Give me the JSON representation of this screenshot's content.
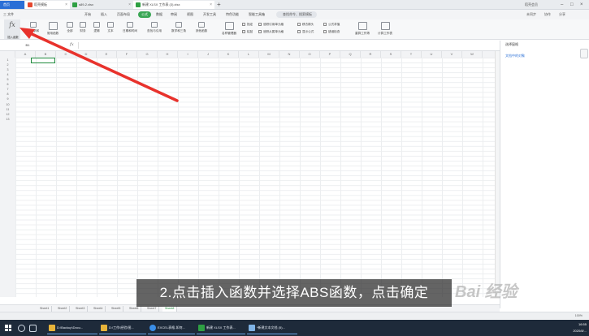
{
  "tabs": {
    "home": "首页",
    "daoke": "稻壳模板",
    "file1": "s89-2.xlsx",
    "file2": "新建 XLSX 工作表 (3).xlsx",
    "plus": "+"
  },
  "window_right": {
    "avatar_label": "稻壳会员",
    "share": "分享"
  },
  "menu": {
    "file": "三 文件",
    "items": [
      "开始",
      "插入",
      "页面布局",
      "公式",
      "数据",
      "审阅",
      "视图",
      "开发工具",
      "特色功能",
      "智能工具箱"
    ],
    "active_index": 3,
    "search": "查找命令、搜索模板",
    "right_items": [
      "未同步",
      "协作",
      "分享"
    ]
  },
  "ribbon": {
    "insert_function": "插入函数",
    "buttons": [
      "自动求和",
      "常用函数",
      "全部",
      "财务",
      "逻辑",
      "文本",
      "日期和时间",
      "查找与引用",
      "数学和三角",
      "其他函数",
      "名称管理器"
    ],
    "small_buttons": [
      "指定",
      "追踪引用单元格",
      "移去箭头",
      "公式求值",
      "粘贴",
      "追踪从属单元格",
      "显示公式",
      "错误检查",
      "重算工作簿",
      "计算工作表"
    ]
  },
  "formula_bar": {
    "cell_ref": "B1",
    "fx": "fx",
    "value": ""
  },
  "columns": [
    "A",
    "B",
    "C",
    "D",
    "E",
    "F",
    "G",
    "H",
    "I",
    "J",
    "K",
    "L",
    "M",
    "N",
    "O",
    "P",
    "Q",
    "R",
    "S",
    "T",
    "U",
    "V",
    "W"
  ],
  "rows": [
    "1",
    "2",
    "3",
    "4",
    "5",
    "6",
    "7",
    "8",
    "9",
    "10",
    "11",
    "12",
    "13"
  ],
  "task_pane": {
    "title": "选择窗格",
    "link": "文档中的对象"
  },
  "sheets": [
    "Sheet1",
    "Sheet2",
    "Sheet3",
    "Sheet4",
    "Sheet5",
    "Sheet6",
    "Sheet7",
    "Sheet8"
  ],
  "active_sheet_index": 7,
  "status": {
    "zoom": "100%"
  },
  "subtitle": "2.点击插入函数并选择ABS函数，点击确定",
  "watermark": "Bai 经验",
  "taskbar": {
    "apps": [
      "D:\\Backup\\Docu...",
      "D:\\工作\\经验\\图...",
      "EXCEL表格-如何...",
      "新建 XLSX 工作表...",
      "*新建文本文档 (5)..."
    ],
    "time": "16:55",
    "date": "2020/8/..."
  },
  "colors": {
    "accent_green": "#3aa655",
    "arrow_red": "#e8322c",
    "taskbar": "#1e2a3a",
    "tab_blue": "#2a6fd6"
  }
}
